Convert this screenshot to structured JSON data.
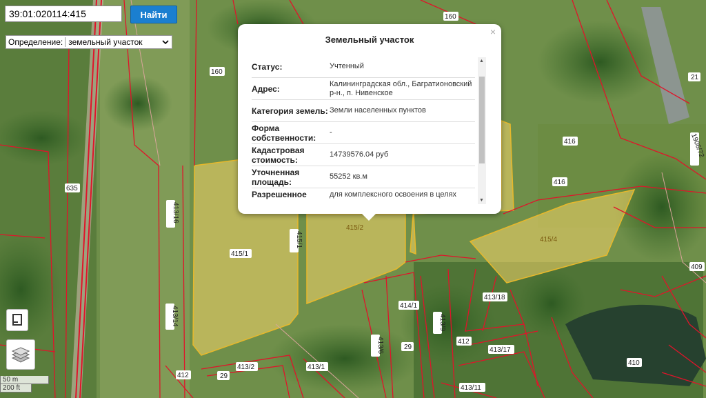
{
  "search": {
    "value": "39:01:020114:415",
    "button": "Найти"
  },
  "definition": {
    "label": "Определение:",
    "selected": "земельный участок"
  },
  "popup": {
    "title": "Земельный участок",
    "close": "×",
    "rows": [
      {
        "key": "Статус:",
        "value": "Учтенный"
      },
      {
        "key": "Адрес:",
        "value": "Калининградская обл., Багратионовский р-н., п. Нивенское"
      },
      {
        "key": "Категория земель:",
        "value": "Земли населенных пунктов"
      },
      {
        "key": "Форма собственности:",
        "value": "-"
      },
      {
        "key": "Кадастровая стоимость:",
        "value": "14739576.04 руб"
      },
      {
        "key": "Уточненная площадь:",
        "value": "55252 кв.м"
      },
      {
        "key": "Разрешенное использование:",
        "value": "для комплексного освоения в целях жилищного строительства"
      }
    ]
  },
  "map_labels": {
    "l160a": "160",
    "l160b": "160",
    "l635": "635",
    "l413_16": "413/16",
    "l415_1": "415/1",
    "l415_1b": "415/1",
    "l415_2": "415/2",
    "l415_4": "415/4",
    "l416a": "416",
    "l416b": "416",
    "l21": "21",
    "l1906": "1906/72",
    "l413_14": "413/14",
    "l414_1": "414/1",
    "l413_9": "413/9",
    "l413_6": "413/6",
    "l29a": "29",
    "l29b": "29",
    "l413_18": "413/18",
    "l412a": "412",
    "l412b": "412",
    "l413_17": "413/17",
    "l413_2": "413/2",
    "l413_1": "413/1",
    "l413_11": "413/11",
    "l409": "409",
    "l410": "410"
  },
  "scale": {
    "metric": "50 m",
    "imperial": "200 ft"
  },
  "colors": {
    "parcel_border": "#e0142a",
    "highlight": "#f5d66a",
    "button": "#1a7fd0"
  }
}
